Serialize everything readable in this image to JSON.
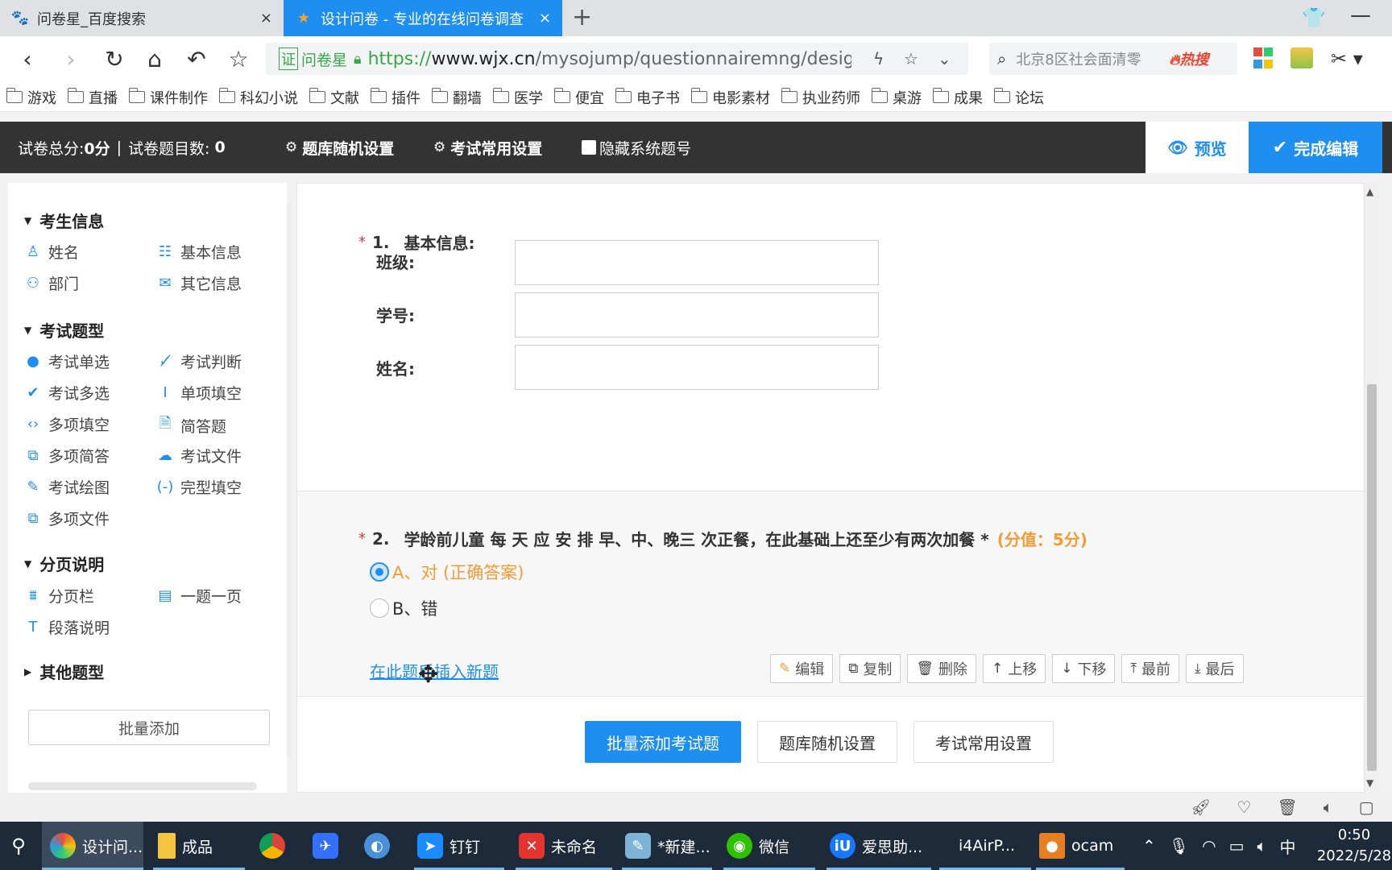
{
  "browser": {
    "tabs": [
      {
        "title": "问卷星_百度搜索",
        "close": "×"
      },
      {
        "title": "设计问卷 - 专业的在线问卷调查",
        "close": "×"
      }
    ],
    "new_tab": "+",
    "url": {
      "site_label": "问卷星",
      "scheme": "https://",
      "host": "www.wjx.cn",
      "path": "/mysojump/questionnairemng/designne"
    },
    "search": {
      "text": "北京8区社会面清零",
      "hot": "热搜"
    },
    "bookmarks": [
      "游戏",
      "直播",
      "课件制作",
      "科幻小说",
      "文献",
      "插件",
      "翻墙",
      "医学",
      "便宜",
      "电子书",
      "电影素材",
      "执业药师",
      "桌游",
      "成果",
      "论坛"
    ]
  },
  "toolbar": {
    "total_score_label": "试卷总分:",
    "total_score_value": "0分",
    "separator": "|",
    "question_count_label": "试卷题目数:",
    "question_count_value": "0",
    "random_settings": "题库随机设置",
    "common_settings": "考试常用设置",
    "hide_numbers": "隐藏系统题号",
    "preview": "预览",
    "finish": "完成编辑"
  },
  "sidebar": {
    "groups": [
      {
        "title": "考生信息",
        "items": [
          {
            "label": "姓名",
            "icon": "person-icon"
          },
          {
            "label": "基本信息",
            "icon": "id-card-icon"
          },
          {
            "label": "部门",
            "icon": "group-icon"
          },
          {
            "label": "其它信息",
            "icon": "mail-icon"
          }
        ]
      },
      {
        "title": "考试题型",
        "items": [
          {
            "label": "考试单选",
            "icon": "radio-dot-icon"
          },
          {
            "label": "考试判断",
            "icon": "judge-icon"
          },
          {
            "label": "考试多选",
            "icon": "check-icon"
          },
          {
            "label": "单项填空",
            "icon": "text-cursor-icon"
          },
          {
            "label": "多项填空",
            "icon": "brackets-icon"
          },
          {
            "label": "简答题",
            "icon": "document-icon"
          },
          {
            "label": "多项简答",
            "icon": "multi-document-icon"
          },
          {
            "label": "考试文件",
            "icon": "cloud-upload-icon"
          },
          {
            "label": "考试绘图",
            "icon": "pen-icon"
          },
          {
            "label": "完型填空",
            "icon": "cloze-icon"
          },
          {
            "label": "多项文件",
            "icon": "multi-file-icon"
          }
        ]
      },
      {
        "title": "分页说明",
        "items": [
          {
            "label": "分页栏",
            "icon": "page-break-icon"
          },
          {
            "label": "一题一页",
            "icon": "one-per-page-icon"
          },
          {
            "label": "段落说明",
            "icon": "paragraph-icon"
          }
        ]
      },
      {
        "title": "其他题型",
        "items": []
      }
    ],
    "batch_add": "批量添加"
  },
  "questions": {
    "q1": {
      "star": "*",
      "number": "1.",
      "title": "基本信息:",
      "fields": [
        {
          "label": "班级:",
          "value": ""
        },
        {
          "label": "学号:",
          "value": ""
        },
        {
          "label": "姓名:",
          "value": ""
        }
      ]
    },
    "q2": {
      "star": "*",
      "number": "2.",
      "title": "学龄前儿童 每 天 应 安 排 早、中、晚三 次正餐，在此基础上还至少有两次加餐 *",
      "score": "(分值：5分)",
      "options": [
        {
          "label": "A、对 (正确答案)",
          "checked": true
        },
        {
          "label": "B、错",
          "checked": false
        }
      ],
      "insert_link": "在此题后插入新题",
      "actions": [
        {
          "label": "编辑",
          "icon": "pencil-icon"
        },
        {
          "label": "复制",
          "icon": "copy-icon"
        },
        {
          "label": "删除",
          "icon": "trash-icon"
        },
        {
          "label": "上移",
          "icon": "arrow-up-icon"
        },
        {
          "label": "下移",
          "icon": "arrow-down-icon"
        },
        {
          "label": "最前",
          "icon": "to-top-icon"
        },
        {
          "label": "最后",
          "icon": "to-bottom-icon"
        }
      ]
    }
  },
  "bottom_actions": {
    "batch_add_exam": "批量添加考试题",
    "random_settings": "题库随机设置",
    "common_settings": "考试常用设置"
  },
  "taskbar": {
    "items": [
      {
        "label": "设计问...",
        "icon": "browser-icon"
      },
      {
        "label": "成品",
        "icon": "folder-icon"
      },
      {
        "label": "",
        "icon": "chrome-icon"
      },
      {
        "label": "",
        "icon": "feishu-icon"
      },
      {
        "label": "",
        "icon": "bird-icon"
      },
      {
        "label": "钉钉",
        "icon": "dingtalk-icon"
      },
      {
        "label": "未命名",
        "icon": "xmind-icon"
      },
      {
        "label": "*新建...",
        "icon": "notepad-icon"
      },
      {
        "label": "微信",
        "icon": "wechat-icon"
      },
      {
        "label": "爱思助...",
        "icon": "aisi-icon"
      },
      {
        "label": "i4AirP...",
        "icon": "airplay-icon"
      },
      {
        "label": "ocam",
        "icon": "ocam-icon"
      }
    ],
    "ime": "中",
    "time": "0:50",
    "date": "2022/5/28"
  },
  "colors": {
    "accent": "#1f8ef1",
    "toolbar_bg": "#333333",
    "score": "#f39c34",
    "required": "#e4393c"
  }
}
